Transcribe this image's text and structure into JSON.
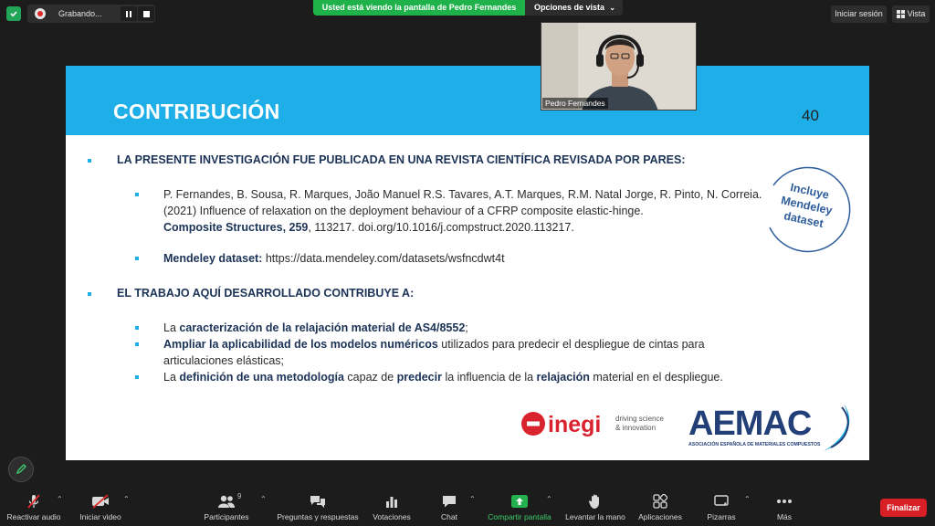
{
  "topbar": {
    "recording_label": "Grabando...",
    "share_banner": "Usted está viendo la pantalla de Pedro Fernandes",
    "view_options": "Opciones de vista",
    "sign_in": "Iniciar sesión",
    "vista": "Vista"
  },
  "slide": {
    "title": "CONTRIBUCIÓN",
    "page_number": "40",
    "heading1": "LA PRESENTE INVESTIGACIÓN FUE PUBLICADA EN UNA REVISTA CIENTÍFICA REVISADA POR PARES:",
    "ref": {
      "authors": "P. Fernandes, B. Sousa, R. Marques, João Manuel R.S. Tavares, A.T. Marques, R.M. Natal Jorge, R. Pinto, N. Correia. (2021) Influence of relaxation on the deployment behaviour of a CFRP composite elastic-hinge.",
      "journal": "Composite Structures, 259",
      "rest": ", 113217. doi.org/10.1016/j.compstruct.2020.113217."
    },
    "dataset": {
      "label": "Mendeley dataset:",
      "url": " https://data.mendeley.com/datasets/wsfncdwt4t"
    },
    "stamp": {
      "line1": "Incluye",
      "line2": "Mendeley",
      "line3": "dataset"
    },
    "heading2": "EL TRABAJO AQUÍ DESARROLLADO CONTRIBUYE A:",
    "c1": {
      "a": "La ",
      "b": "caracterización de la relajación material de AS4/8552",
      "c": ";"
    },
    "c2": {
      "a": "Ampliar la aplicabilidad de los modelos numéricos",
      "b": " utilizados para predecir el despliegue de cintas para articulaciones elásticas;"
    },
    "c3": {
      "a": "La ",
      "b": "definición de una metodología",
      "c": " capaz de ",
      "d": "predecir",
      "e": " la influencia de la ",
      "f": "relajación",
      "g": " material en el despliegue."
    },
    "logo_inegi": {
      "name": "inegi",
      "tag1": "driving science",
      "tag2": "& innovation"
    },
    "logo_aemac": {
      "name": "AEMAC",
      "sub": "ASOCIACIÓN ESPAÑOLA DE MATERIALES COMPUESTOS"
    }
  },
  "video": {
    "participant_name": "Pedro Fernandes"
  },
  "toolbar": {
    "mute": "Reactivar audio",
    "video": "Iniciar video",
    "participants": "Participantes",
    "participants_count": "9",
    "qa": "Preguntas y respuestas",
    "polls": "Votaciones",
    "chat": "Chat",
    "share": "Compartir pantalla",
    "raise_hand": "Levantar la mano",
    "apps": "Aplicaciones",
    "whiteboards": "Pizarras",
    "more": "Más",
    "end": "Finalizar"
  },
  "colors": {
    "accent_blue": "#1eaee8",
    "navy": "#1c3357",
    "share_green": "#1fb24a",
    "end_red": "#d91f26",
    "inegi_red": "#d9232e"
  },
  "icons": [
    "shield-check-icon",
    "record-icon",
    "pause-icon",
    "stop-icon",
    "vista-grid-icon",
    "pen-icon",
    "mic-off-icon",
    "video-off-icon",
    "participants-icon",
    "qa-icon",
    "polls-icon",
    "chat-icon",
    "share-screen-icon",
    "raise-hand-icon",
    "apps-icon",
    "whiteboard-icon",
    "more-icon"
  ]
}
